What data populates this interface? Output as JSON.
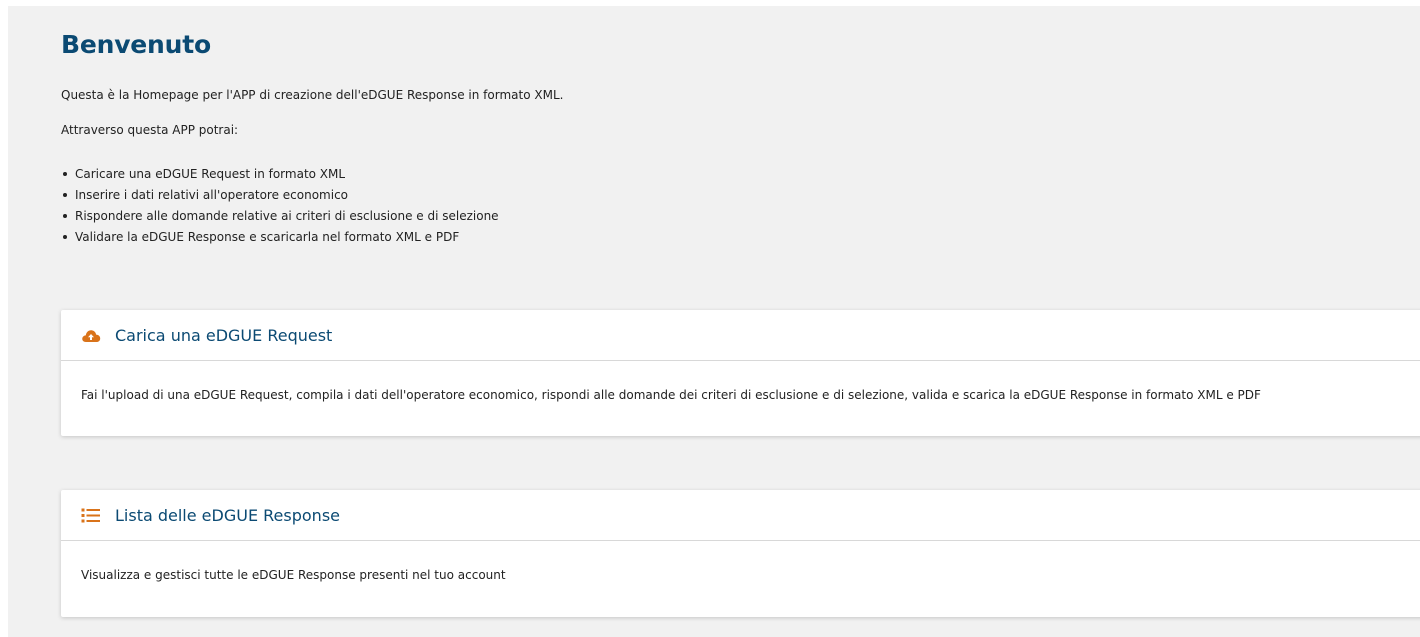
{
  "page": {
    "title": "Benvenuto",
    "intro": "Questa è la Homepage per l'APP di creazione dell'eDGUE Response in formato XML.",
    "intro2": "Attraverso questa APP potrai:",
    "features": [
      "Caricare una eDGUE Request in formato XML",
      "Inserire i dati relativi all'operatore economico",
      "Rispondere alle domande relative ai criteri di esclusione e di selezione",
      "Validare la eDGUE Response e scaricarla nel formato XML e PDF"
    ]
  },
  "cards": [
    {
      "icon": "cloud-upload-icon",
      "title": "Carica una eDGUE Request",
      "body": "Fai l'upload di una eDGUE Request, compila i dati dell'operatore economico, rispondi alle domande dei criteri di esclusione e di selezione, valida e scarica la eDGUE Response in formato XML e PDF"
    },
    {
      "icon": "list-icon",
      "title": "Lista delle eDGUE Response",
      "body": "Visualizza e gestisci tutte le eDGUE Response presenti nel tuo account"
    }
  ],
  "colors": {
    "accent": "#0b4a73",
    "icon": "#d9731a",
    "button": "#0b5d8f",
    "background": "#f1f1f1"
  }
}
